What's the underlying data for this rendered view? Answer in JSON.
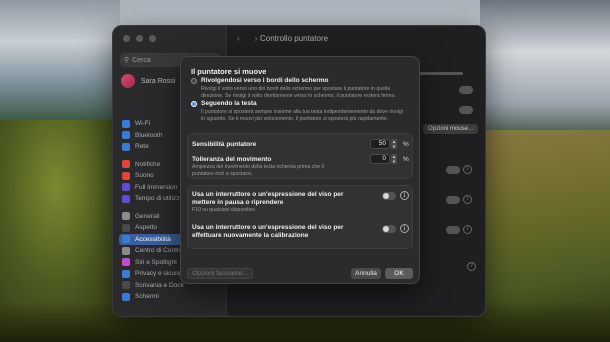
{
  "window": {
    "title": "Controllo puntatore",
    "search_placeholder": "Cerca",
    "user_label": "Sara Rossi"
  },
  "sidebar": {
    "items": [
      {
        "label": "Wi-Fi",
        "color": "#3a7bd5"
      },
      {
        "label": "Bluetooth",
        "color": "#3a7bd5"
      },
      {
        "label": "Rete",
        "color": "#3a7bd5"
      },
      {
        "label": "Notifiche",
        "color": "#e0453a"
      },
      {
        "label": "Suono",
        "color": "#e0453a"
      },
      {
        "label": "Full immersion",
        "color": "#5a4fcf"
      },
      {
        "label": "Tempo di utilizzo",
        "color": "#5a4fcf"
      },
      {
        "label": "Generali",
        "color": "#8a8a8a"
      },
      {
        "label": "Aspetto",
        "color": "#4a4a4a"
      },
      {
        "label": "Accessibilità",
        "color": "#3a7bd5",
        "active": true
      },
      {
        "label": "Centro di Controllo",
        "color": "#8a8a8a"
      },
      {
        "label": "Siri e Spotlight",
        "color": "#c04fd0"
      },
      {
        "label": "Privacy e sicurezza",
        "color": "#3a7bd5"
      },
      {
        "label": "Scrivania e Dock",
        "color": "#4a4a4a"
      },
      {
        "label": "Schermi",
        "color": "#3a7bd5"
      }
    ]
  },
  "background_controls": {
    "options_button": "Opzioni mouse..."
  },
  "sheet": {
    "heading": "Il puntatore si muove",
    "option1": {
      "title": "Rivolgendosi verso i bordi dello schermo",
      "desc": "Rivolgi il volto verso uno dei bordi dello schermo per spostare il puntatore in quella direzione. Se rivolgi il volto direttamente verso lo schermo, il puntatore resterà fermo."
    },
    "option2": {
      "title": "Seguendo la testa",
      "desc": "Il puntatore si sposterà sempre insieme alla tua testa indipendentemente da dove rivolgi lo sguardo. Se ti muovi più velocemente, il puntatore si sposterà più rapidamente."
    },
    "sensitivity": {
      "label": "Sensibilità puntatore",
      "value": "50",
      "unit": "%"
    },
    "tolerance": {
      "label": "Tolleranza del movimento",
      "desc": "Ampiezza del movimento della testa richiesta prima che il puntatore inizi a spostarsi.",
      "value": "0",
      "unit": "%"
    },
    "switch1": {
      "title": "Usa un interruttore o un'espressione del viso per mettere in pausa o riprendere",
      "desc": "F10 su qualsiasi dispositivo"
    },
    "switch2": {
      "title": "Usa un interruttore o un'espressione del viso per effettuare nuovamente la calibrazione"
    },
    "buttons": {
      "face_options": "Opzioni facciame...",
      "cancel": "Annulla",
      "ok": "OK"
    }
  }
}
